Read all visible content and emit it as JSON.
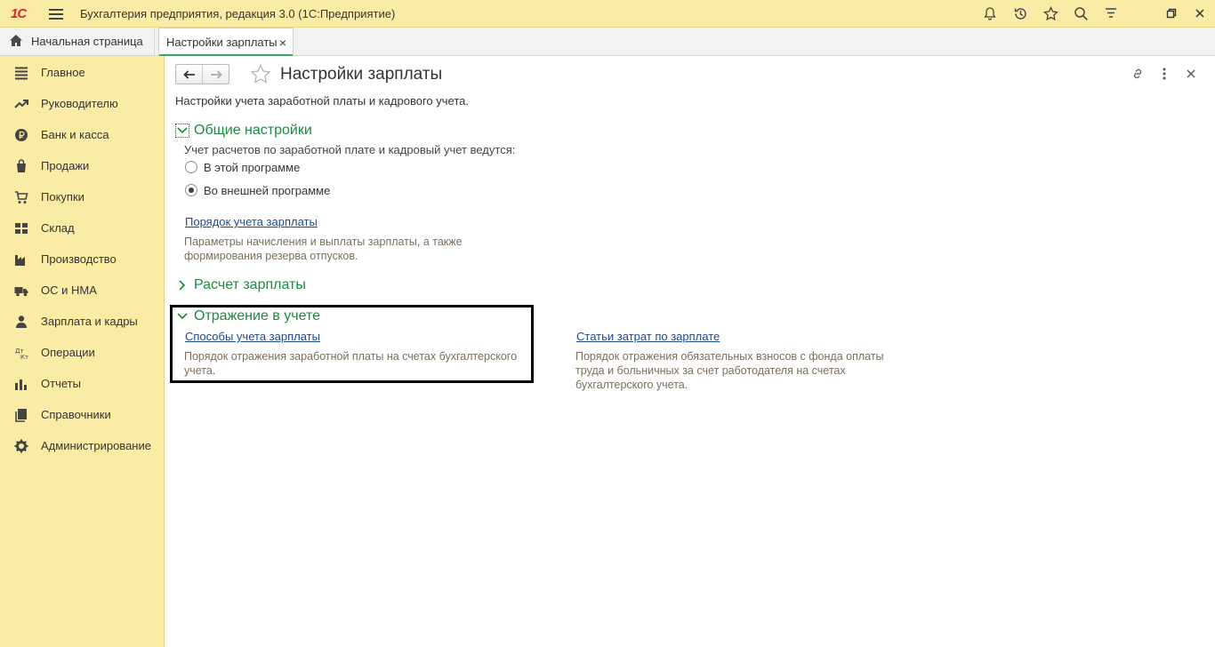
{
  "titlebar": {
    "logo": "1С",
    "app_title": "Бухгалтерия предприятия, редакция 3.0  (1С:Предприятие)",
    "icons": [
      "bell-icon",
      "history-icon",
      "star-icon",
      "search-icon",
      "settings-icon",
      "restore-window-icon"
    ]
  },
  "tabs": {
    "home_label": "Начальная страница",
    "active_label": "Настройки зарплаты",
    "active_close": "×"
  },
  "sidebar": {
    "items": [
      {
        "label": "Главное",
        "icon": "menu-lines-icon"
      },
      {
        "label": "Руководителю",
        "icon": "trend-icon"
      },
      {
        "label": "Банк и касса",
        "icon": "ruble-coin-icon"
      },
      {
        "label": "Продажи",
        "icon": "shopping-bag-icon"
      },
      {
        "label": "Покупки",
        "icon": "cart-icon"
      },
      {
        "label": "Склад",
        "icon": "warehouse-grid-icon"
      },
      {
        "label": "Производство",
        "icon": "factory-icon"
      },
      {
        "label": "ОС и НМА",
        "icon": "truck-icon"
      },
      {
        "label": "Зарплата и кадры",
        "icon": "person-icon"
      },
      {
        "label": "Операции",
        "icon": "debit-credit-icon"
      },
      {
        "label": "Отчеты",
        "icon": "bar-chart-icon"
      },
      {
        "label": "Справочники",
        "icon": "books-icon"
      },
      {
        "label": "Администрирование",
        "icon": "gear-icon"
      }
    ]
  },
  "main": {
    "title": "Настройки зарплаты",
    "subtitle": "Настройки учета заработной платы и кадрового учета.",
    "general": {
      "title": "Общие настройки",
      "question": "Учет расчетов по заработной плате и кадровый учет ведутся:",
      "options": [
        {
          "label": "В этой программе",
          "selected": false
        },
        {
          "label": "Во внешней программе",
          "selected": true
        }
      ],
      "link": "Порядок учета зарплаты",
      "link_desc_1": "Параметры начисления и выплаты зарплаты, а также",
      "link_desc_2": "формирования резерва отпусков."
    },
    "payroll": {
      "title": "Расчет зарплаты"
    },
    "accounting": {
      "title": "Отражение в учете",
      "link1": "Способы учета зарплаты",
      "link1_desc_1": "Порядок отражения заработной платы на счетах бухгалтерского",
      "link1_desc_2": "учета.",
      "link2": "Статьи затрат по зарплате",
      "link2_desc_1": "Порядок отражения обязательных взносов с фонда оплаты",
      "link2_desc_2": "труда и больничных за счет работодателя на счетах",
      "link2_desc_3": "бухгалтерского учета."
    }
  },
  "colors": {
    "sidebar_bg": "#fbeca5",
    "section_green": "#1b8a3f",
    "link_blue": "#1c4a8f",
    "desc_brown": "#7a6e5a"
  }
}
